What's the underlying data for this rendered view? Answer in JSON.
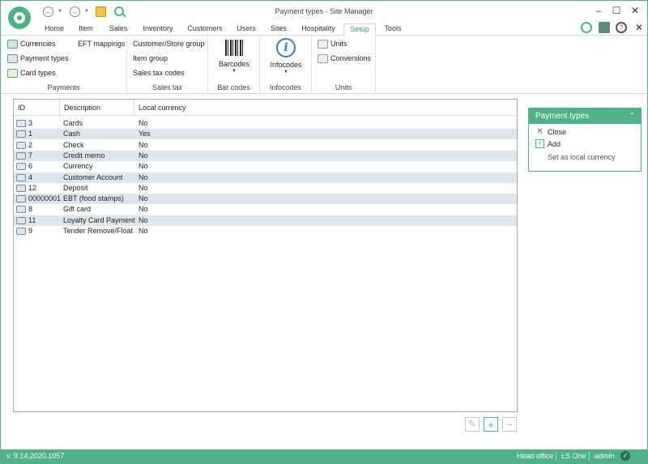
{
  "window": {
    "title": "Payment types - Site Manager",
    "minimize": "–",
    "maximize": "☐",
    "close": "✕"
  },
  "quick_access": {
    "back": "←",
    "forward": "→",
    "caret": "▼"
  },
  "tabs": [
    "Home",
    "Item",
    "Sales",
    "Inventory",
    "Customers",
    "Users",
    "Sites",
    "Hospitality",
    "Setup",
    "Tools"
  ],
  "active_tab": "Setup",
  "ribbon": {
    "payments": {
      "label": "Payments",
      "items": [
        "Currencies",
        "Payment types",
        "Card types"
      ],
      "eft": "EFT mappings"
    },
    "sales_tax": {
      "label": "Sales tax",
      "items": [
        "Customer/Store group",
        "Item group",
        "Sales tax codes"
      ]
    },
    "bar_codes": {
      "label": "Bar codes",
      "button": "Barcodes",
      "caret": "▼"
    },
    "infocodes": {
      "label": "Infocodes",
      "button": "Infocodes",
      "caret": "▼",
      "glyph": "i"
    },
    "units": {
      "label": "Units",
      "items": [
        "Units",
        "Conversions"
      ]
    }
  },
  "grid": {
    "columns": [
      "ID",
      "Description",
      "Local currency"
    ],
    "rows": [
      {
        "id": "3",
        "description": "Cards",
        "local": "No"
      },
      {
        "id": "1",
        "description": "Cash",
        "local": "Yes"
      },
      {
        "id": "2",
        "description": "Check",
        "local": "No"
      },
      {
        "id": "7",
        "description": "Credit memo",
        "local": "No"
      },
      {
        "id": "6",
        "description": "Currency",
        "local": "No"
      },
      {
        "id": "4",
        "description": "Customer Account",
        "local": "No"
      },
      {
        "id": "12",
        "description": "Deposit",
        "local": "No"
      },
      {
        "id": "00000001",
        "description": "EBT (food stamps)",
        "local": "No"
      },
      {
        "id": "8",
        "description": "Gift card",
        "local": "No"
      },
      {
        "id": "11",
        "description": "Loyalty Card Payment",
        "local": "No"
      },
      {
        "id": "9",
        "description": "Tender Remove/Float",
        "local": "No"
      }
    ]
  },
  "actions": {
    "edit": "✎",
    "add": "+",
    "remove": "−"
  },
  "panel": {
    "title": "Payment types",
    "collapse": "⌃",
    "close": "Close",
    "close_glyph": "✕",
    "add": "Add",
    "add_glyph": "+",
    "set_local": "Set as local currency"
  },
  "status": {
    "version": "v. 9.14.2020.1057",
    "store": "Head office",
    "product": "LS One",
    "user": "admin",
    "ok_glyph": "✓"
  },
  "colors": {
    "accent": "#4fb286",
    "row_alt": "#dde6ec"
  }
}
